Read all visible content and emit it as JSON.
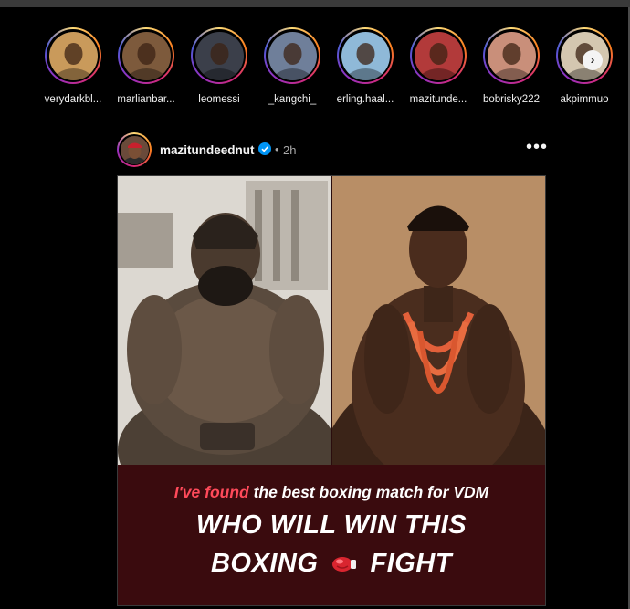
{
  "stories": [
    {
      "username": "verydarkbl...",
      "avatar_color": "#c99a5b"
    },
    {
      "username": "marlianbar...",
      "avatar_color": "#7d5a3c"
    },
    {
      "username": "leomessi",
      "avatar_color": "#3b3f4a"
    },
    {
      "username": "_kangchi_",
      "avatar_color": "#6f7f9a"
    },
    {
      "username": "erling.haal...",
      "avatar_color": "#8fb9d8"
    },
    {
      "username": "mazitunde...",
      "avatar_color": "#b23a3a"
    },
    {
      "username": "bobrisky222",
      "avatar_color": "#c98f7a"
    },
    {
      "username": "akpimmuo",
      "avatar_color": "#d4c7b0"
    }
  ],
  "stories_next_icon": "chevron-right-icon",
  "post": {
    "username": "mazitundeednut",
    "verified": true,
    "separator": "•",
    "time": "2h",
    "more_icon": "•••",
    "banner": {
      "line1_highlight": "I've found",
      "line1_rest": " the best boxing match for VDM",
      "line2": "WHO WILL WIN THIS",
      "line3_a": "BOXING",
      "line3_b": "FIGHT",
      "glove_icon": "boxing-glove-icon"
    }
  },
  "colors": {
    "background": "#000000",
    "banner_bg": "#3a0b0e",
    "highlight": "#ff4a5a",
    "verified": "#0095f6"
  }
}
